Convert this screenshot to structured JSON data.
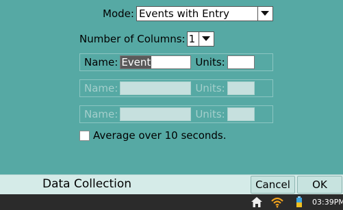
{
  "mode": {
    "label": "Mode:",
    "value": "Events with Entry"
  },
  "columns": {
    "label": "Number of Columns:",
    "value": "1"
  },
  "entries": [
    {
      "name_label": "Name:",
      "name_value": "Event",
      "units_label": "Units:",
      "units_value": "",
      "enabled": true
    },
    {
      "name_label": "Name:",
      "name_value": "",
      "units_label": "Units:",
      "units_value": "",
      "enabled": false
    },
    {
      "name_label": "Name:",
      "name_value": "",
      "units_label": "Units:",
      "units_value": "",
      "enabled": false
    }
  ],
  "average": {
    "label": "Average over 10 seconds.",
    "checked": false
  },
  "bottom_bar": {
    "title": "Data Collection",
    "cancel_label": "Cancel",
    "ok_label": "OK"
  },
  "status_bar": {
    "time": "03:39PM",
    "icons": [
      "home-icon",
      "wifi-icon",
      "battery-icon"
    ]
  },
  "colors": {
    "background": "#56a9a4",
    "bottom_bar": "#d5ebe8",
    "status_bar": "#2b2b2b"
  }
}
